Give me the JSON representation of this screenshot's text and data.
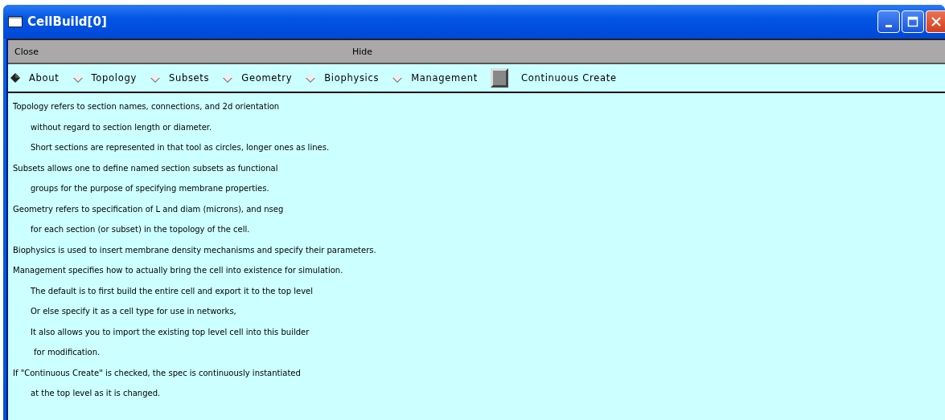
{
  "window": {
    "title": "CellBuild[0]"
  },
  "menu": [
    "Close",
    "Hide"
  ],
  "tabs": [
    {
      "label": "About",
      "selected": true
    },
    {
      "label": "Topology",
      "selected": false
    },
    {
      "label": "Subsets",
      "selected": false
    },
    {
      "label": "Geometry",
      "selected": false
    },
    {
      "label": "Biophysics",
      "selected": false
    },
    {
      "label": "Management",
      "selected": false
    }
  ],
  "continuous_create": {
    "label": "Continuous Create",
    "checked": false
  },
  "text": [
    {
      "text": "Topology refers to section names, connections, and 2d orientation",
      "children": [
        {
          "text": "without regard to section length or diameter."
        },
        {
          "text": "Short sections are represented in that tool as circles, longer ones as lines."
        }
      ]
    },
    {
      "text": "Subsets allows one to define named section subsets as functional",
      "children": [
        {
          "text": "groups for the purpose of specifying membrane properties."
        }
      ]
    },
    {
      "text": "Geometry refers to specification of L and diam (microns), and nseg",
      "children": [
        {
          "text": "for each section (or subset) in the topology of the cell."
        }
      ]
    },
    {
      "text": "Biophysics is used to insert membrane density mechanisms and specify their parameters."
    },
    {
      "text": "Management specifies how to actually bring the cell into existence for simulation.",
      "children": [
        {
          "text": "The default is to first build the entire cell and export it to the top level"
        },
        {
          "text": "Or else specify it as a cell type for use in networks,"
        },
        {
          "text": "It also allows you to import the existing top level cell into this builder",
          "children": [
            {
              "text": "for modification."
            }
          ]
        }
      ]
    },
    {
      "text": "If \"Continuous Create\" is checked, the spec is continuously instantiated",
      "children": [
        {
          "text": "at the top level as it is changed."
        }
      ]
    }
  ]
}
